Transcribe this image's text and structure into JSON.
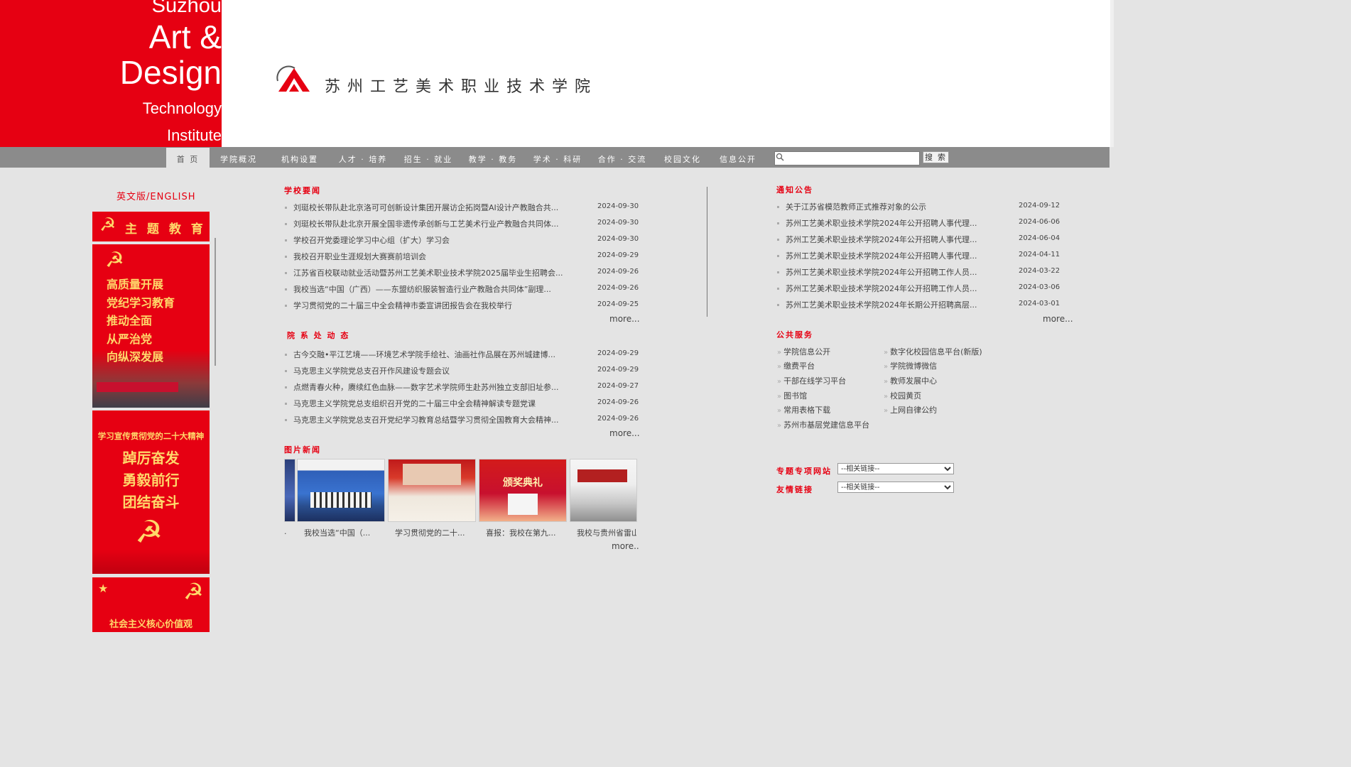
{
  "header": {
    "english_lines": [
      "Suzhou",
      "Art &",
      "Design",
      "Technology",
      "Institute"
    ],
    "cn_name": "苏州工艺美术职业技术学院"
  },
  "nav": {
    "items": [
      "首 页",
      "学院概况",
      "机构设置",
      "人才 · 培养",
      "招生 · 就业",
      "教学 · 教务",
      "学术 · 科研",
      "合作 · 交流",
      "校园文化",
      "信息公开"
    ],
    "active_index": 0,
    "search_button": "搜 索",
    "search_value": ""
  },
  "sidebar": {
    "english_link": "英文版/ENGLISH",
    "banner1": "主 题 教 育",
    "banner2_lines": [
      "高质量开展",
      "党纪学习教育",
      "推动全面",
      "从严治党",
      "向纵深发展"
    ],
    "banner3_heading": "学习宣传贯彻党的二十大精神",
    "banner3_lines": [
      "踔厉奋发",
      "勇毅前行",
      "团结奋斗"
    ],
    "banner4": "社会主义核心价值观"
  },
  "school_news": {
    "title": "学校要闻",
    "items": [
      {
        "text": "刘珽校长带队赴北京洛可可创新设计集团开展访企拓岗暨AI设计产教融合共...",
        "date": "2024-09-30"
      },
      {
        "text": "刘珽校长带队赴北京开展全国非遗传承创新与工艺美术行业产教融合共同体...",
        "date": "2024-09-30"
      },
      {
        "text": "学校召开党委理论学习中心组（扩大）学习会",
        "date": "2024-09-30"
      },
      {
        "text": "我校召开职业生涯规划大赛赛前培训会",
        "date": "2024-09-29"
      },
      {
        "text": "江苏省百校联动就业活动暨苏州工艺美术职业技术学院2025届毕业生招聘会...",
        "date": "2024-09-26"
      },
      {
        "text": "我校当选“中国（广西）——东盟纺织服装智造行业产教融合共同体”副理...",
        "date": "2024-09-26"
      },
      {
        "text": "学习贯彻党的二十届三中全会精神市委宣讲团报告会在我校举行",
        "date": "2024-09-25"
      }
    ],
    "more": "more..."
  },
  "dept_news": {
    "title": "院 系 处 动 态",
    "items": [
      {
        "text": "古今交融•平江艺境——环境艺术学院手绘社、油画社作品展在苏州城建博...",
        "date": "2024-09-29"
      },
      {
        "text": "马克思主义学院党总支召开作风建设专题会议",
        "date": "2024-09-29"
      },
      {
        "text": "点燃青春火种，赓续红色血脉——数字艺术学院师生赴苏州独立支部旧址参...",
        "date": "2024-09-27"
      },
      {
        "text": "马克思主义学院党总支组织召开党的二十届三中全会精神解读专题党课",
        "date": "2024-09-26"
      },
      {
        "text": "马克思主义学院党总支召开党纪学习教育总结暨学习贯彻全国教育大会精神...",
        "date": "2024-09-26"
      }
    ],
    "more": "more..."
  },
  "photo_news": {
    "title": "图片新闻",
    "captions": [
      ".",
      "我校当选“中国（...",
      "学习贯彻党的二十...",
      "喜报：我校在第九...",
      "我校与贵州省雷山"
    ],
    "photo_texts": [
      "颁奖典礼"
    ],
    "more": "more.."
  },
  "notices": {
    "title": "通知公告",
    "items": [
      {
        "text": "关于江苏省模范教师正式推荐对象的公示",
        "date": "2024-09-12"
      },
      {
        "text": "苏州工艺美术职业技术学院2024年公开招聘人事代理...",
        "date": "2024-06-06"
      },
      {
        "text": "苏州工艺美术职业技术学院2024年公开招聘人事代理...",
        "date": "2024-06-04"
      },
      {
        "text": "苏州工艺美术职业技术学院2024年公开招聘人事代理...",
        "date": "2024-04-11"
      },
      {
        "text": "苏州工艺美术职业技术学院2024年公开招聘工作人员...",
        "date": "2024-03-22"
      },
      {
        "text": "苏州工艺美术职业技术学院2024年公开招聘工作人员...",
        "date": "2024-03-06"
      },
      {
        "text": "苏州工艺美术职业技术学院2024年长期公开招聘高层...",
        "date": "2024-03-01"
      }
    ],
    "more": "more..."
  },
  "services": {
    "title": "公共服务",
    "col1": [
      "学院信息公开",
      "缴费平台",
      "干部在线学习平台",
      "图书馆",
      "常用表格下载",
      "苏州市基层党建信息平台"
    ],
    "col2": [
      "数字化校园信息平台(新版)",
      "学院微博微信",
      "教师发展中心",
      "校园黄页",
      "上网自律公约"
    ]
  },
  "links": {
    "special_label": "专题专项网站",
    "special_selected": "--相关链接--",
    "friend_label": "友情链接",
    "friend_selected": "--相关链接--"
  },
  "colors": {
    "brand_red": "#e60012",
    "nav_gray": "#8b8b8b",
    "page_bg": "#e4e4e4"
  }
}
